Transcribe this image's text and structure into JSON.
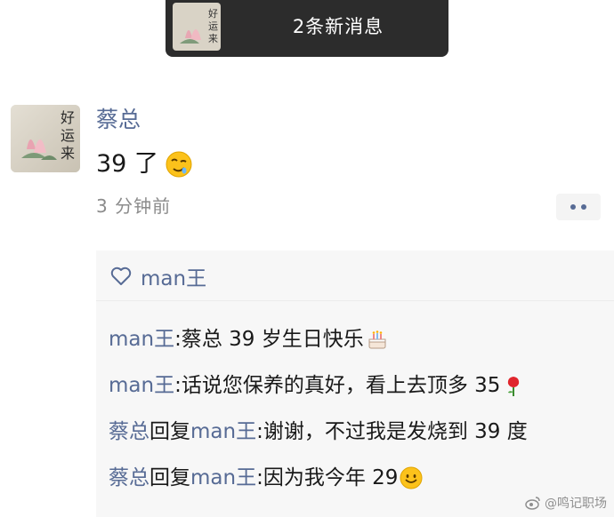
{
  "banner": {
    "text": "2条新消息"
  },
  "post": {
    "author": "蔡总",
    "text": "39 了",
    "emoji": "drooling-face",
    "time": "3 分钟前",
    "avatar_text": "好运来"
  },
  "likes": {
    "names": "man王"
  },
  "comments": [
    {
      "from": "man王",
      "to": "",
      "text": "蔡总 39 岁生日快乐",
      "emoji": "birthday-cake"
    },
    {
      "from": "man王",
      "to": "",
      "text": "话说您保养的真好，看上去顶多 35",
      "emoji": "rose"
    },
    {
      "from": "蔡总",
      "to": "man王",
      "text": "谢谢，不过我是发烧到 39 度",
      "emoji": ""
    },
    {
      "from": "蔡总",
      "to": "man王",
      "text": "因为我今年 29",
      "emoji": "smiling-face"
    }
  ],
  "labels": {
    "reply": "回复",
    "colon": ": "
  },
  "watermark": "@鸣记职场",
  "colors": {
    "link_blue": "#576b95",
    "banner_bg": "#2c2c2c",
    "comment_bg": "#f7f7f7",
    "time_gray": "#8b8b8b"
  }
}
